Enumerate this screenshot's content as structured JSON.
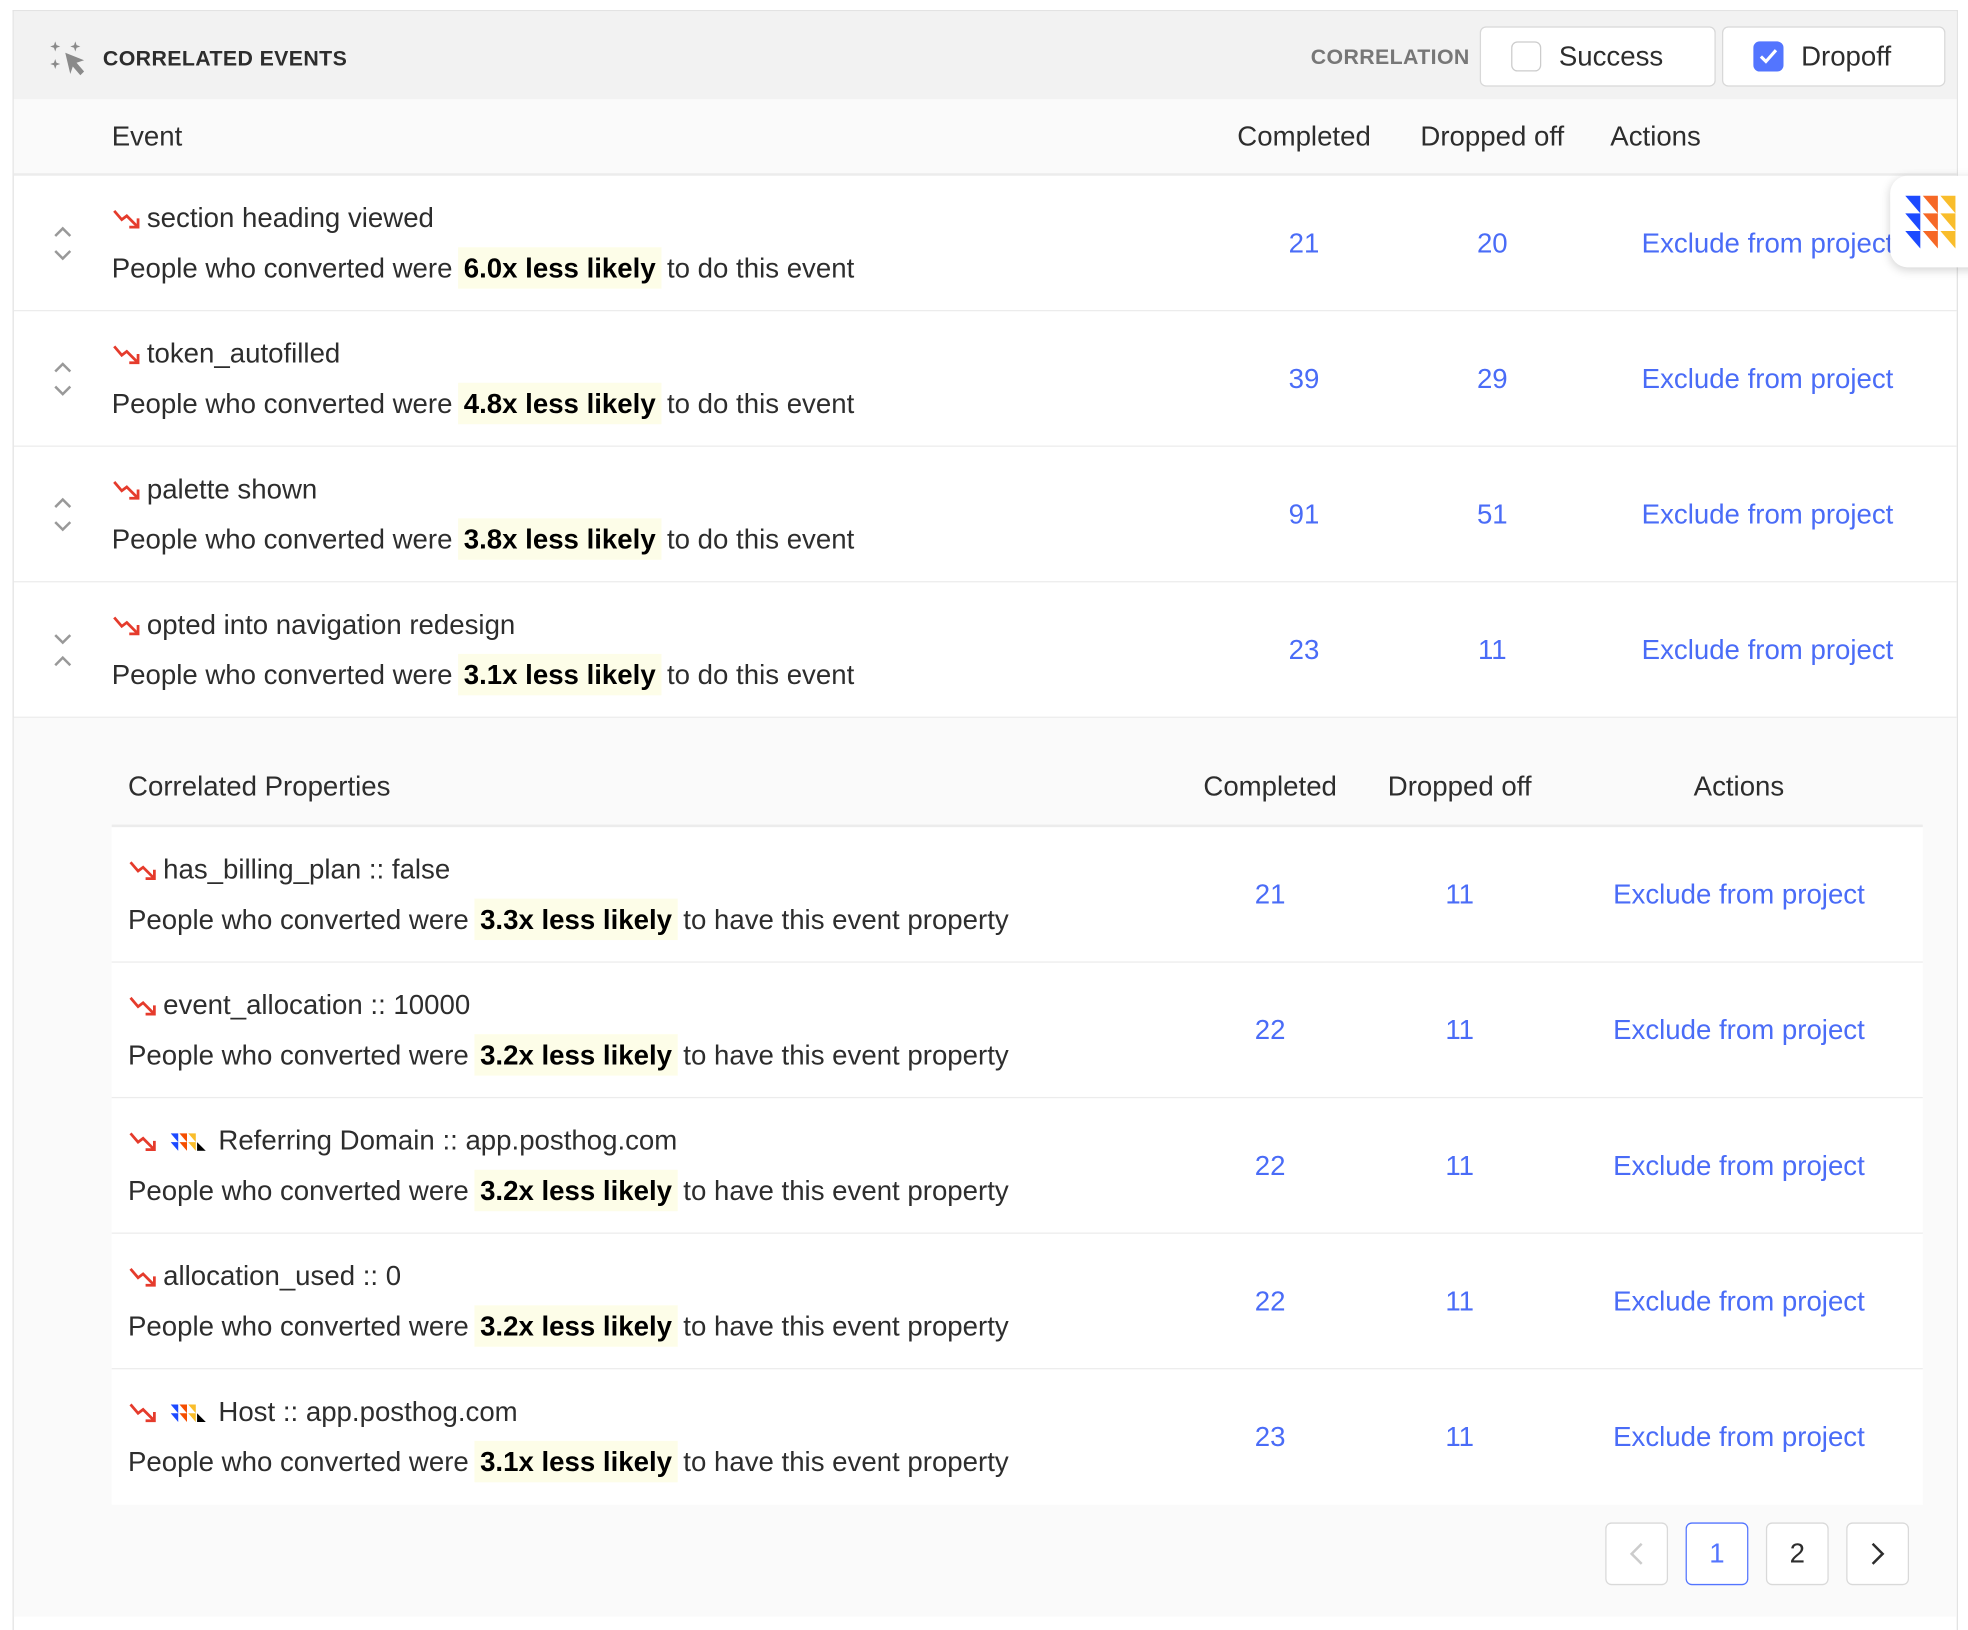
{
  "header": {
    "title": "CORRELATED EVENTS",
    "icon": "sparkle-cursor-icon",
    "correlation_label": "CORRELATION",
    "toggles": [
      {
        "label": "Success",
        "checked": false
      },
      {
        "label": "Dropoff",
        "checked": true
      }
    ]
  },
  "columns": {
    "event": "Event",
    "completed": "Completed",
    "dropped_off": "Dropped off",
    "actions": "Actions"
  },
  "events": [
    {
      "name": "section heading viewed",
      "prefix": "People who converted were",
      "likelihood": "6.0x less likely",
      "suffix": "to do this event",
      "completed": "21",
      "dropped_off": "20",
      "action": "Exclude from project",
      "expanded": false
    },
    {
      "name": "token_autofilled",
      "prefix": "People who converted were",
      "likelihood": "4.8x less likely",
      "suffix": "to do this event",
      "completed": "39",
      "dropped_off": "29",
      "action": "Exclude from project",
      "expanded": false
    },
    {
      "name": "palette shown",
      "prefix": "People who converted were",
      "likelihood": "3.8x less likely",
      "suffix": "to do this event",
      "completed": "91",
      "dropped_off": "51",
      "action": "Exclude from project",
      "expanded": false
    },
    {
      "name": "opted into navigation redesign",
      "prefix": "People who converted were",
      "likelihood": "3.1x less likely",
      "suffix": "to do this event",
      "completed": "23",
      "dropped_off": "11",
      "action": "Exclude from project",
      "expanded": true
    }
  ],
  "properties": {
    "columns": {
      "property": "Correlated Properties",
      "completed": "Completed",
      "dropped_off": "Dropped off",
      "actions": "Actions"
    },
    "rows": [
      {
        "name": "has_billing_plan :: false",
        "logo": false,
        "prefix": "People who converted were",
        "likelihood": "3.3x less likely",
        "suffix": "to have this event property",
        "completed": "21",
        "dropped_off": "11",
        "action": "Exclude from project"
      },
      {
        "name": "event_allocation :: 10000",
        "logo": false,
        "prefix": "People who converted were",
        "likelihood": "3.2x less likely",
        "suffix": "to have this event property",
        "completed": "22",
        "dropped_off": "11",
        "action": "Exclude from project"
      },
      {
        "name": "Referring Domain :: app.posthog.com",
        "logo": true,
        "prefix": "People who converted were",
        "likelihood": "3.2x less likely",
        "suffix": "to have this event property",
        "completed": "22",
        "dropped_off": "11",
        "action": "Exclude from project"
      },
      {
        "name": "allocation_used :: 0",
        "logo": false,
        "prefix": "People who converted were",
        "likelihood": "3.2x less likely",
        "suffix": "to have this event property",
        "completed": "22",
        "dropped_off": "11",
        "action": "Exclude from project"
      },
      {
        "name": "Host :: app.posthog.com",
        "logo": true,
        "prefix": "People who converted were",
        "likelihood": "3.1x less likely",
        "suffix": "to have this event property",
        "completed": "23",
        "dropped_off": "11",
        "action": "Exclude from project"
      }
    ]
  },
  "pagination": {
    "pages": [
      "1",
      "2"
    ],
    "current": "1",
    "prev_icon": "chevron-left-icon",
    "next_icon": "chevron-right-icon"
  },
  "colors": {
    "accent": "#5375ff",
    "link": "#4a6cf7",
    "trend_down": "#e53b2c",
    "highlight": "#fdfde8"
  }
}
